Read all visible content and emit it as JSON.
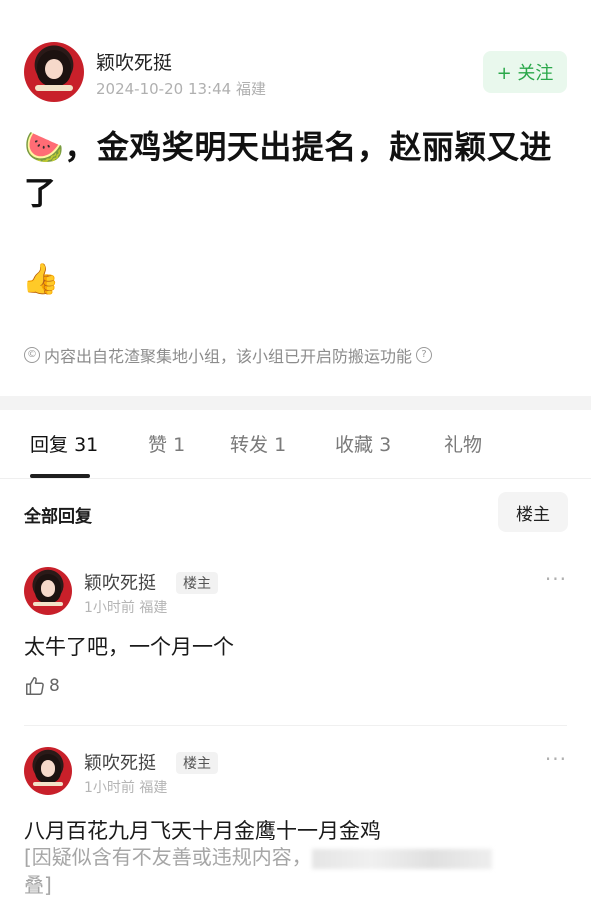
{
  "post": {
    "author": "颖吹死挺",
    "date": "2024-10-20 13:44",
    "location": "福建",
    "follow_label": "+ 关注",
    "title_emoji": "🍉",
    "title": "，金鸡奖明天出提名，赵丽颖又进了",
    "body_emoji": "👍",
    "source_icon": "©",
    "source_note": "内容出自花渣聚集地小组，该小组已开启防搬运功能",
    "help_icon": "?"
  },
  "tabs": [
    {
      "label": "回复",
      "count": "31"
    },
    {
      "label": "赞",
      "count": "1"
    },
    {
      "label": "转发",
      "count": "1"
    },
    {
      "label": "收藏",
      "count": "3"
    },
    {
      "label": "礼物",
      "count": ""
    }
  ],
  "replies_header": {
    "all_label": "全部回复",
    "owner_filter_label": "楼主"
  },
  "comments": [
    {
      "author": "颖吹死挺",
      "badge": "楼主",
      "time": "1小时前",
      "location": "福建",
      "text": "太牛了吧，一个月一个",
      "likes": "8",
      "more": "···"
    },
    {
      "author": "颖吹死挺",
      "badge": "楼主",
      "time": "1小时前",
      "location": "福建",
      "text": "八月百花九月飞天十月金鹰十一月金鸡",
      "folded_prefix": "[因疑似含有不友善或违规内容，",
      "folded_suffix": "叠]",
      "more": "···"
    }
  ],
  "colors": {
    "accent_green": "#2aa84a",
    "follow_bg": "#e9f8ed",
    "muted": "#b0b0b0"
  }
}
